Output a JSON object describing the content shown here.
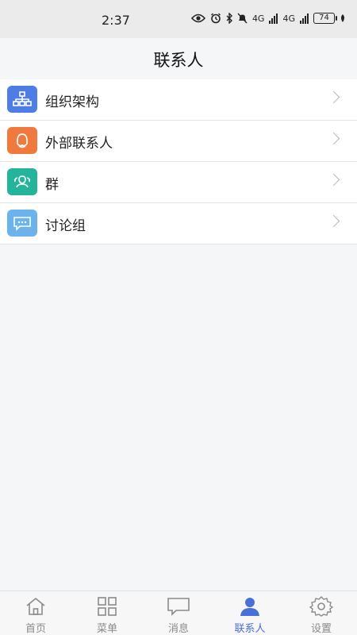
{
  "status_bar": {
    "time": "2:37",
    "battery": "74",
    "network_1": "4G",
    "network_2": "4G"
  },
  "header": {
    "title": "联系人"
  },
  "contacts": [
    {
      "label": "组织架构",
      "icon": "org-chart-icon",
      "color": "#4f7de6"
    },
    {
      "label": "外部联系人",
      "icon": "person-outline-icon",
      "color": "#f07a3e"
    },
    {
      "label": "群",
      "icon": "group-icon",
      "color": "#24b39b"
    },
    {
      "label": "讨论组",
      "icon": "chat-bubble-icon",
      "color": "#6cb3ee"
    }
  ],
  "bottom_nav": [
    {
      "label": "首页",
      "icon": "home-icon",
      "active": false
    },
    {
      "label": "菜单",
      "icon": "grid-icon",
      "active": false
    },
    {
      "label": "消息",
      "icon": "message-icon",
      "active": false
    },
    {
      "label": "联系人",
      "icon": "contact-icon",
      "active": true
    },
    {
      "label": "设置",
      "icon": "gear-icon",
      "active": false
    }
  ],
  "colors": {
    "accent": "#4a6fd8",
    "inactive": "#8a8a8a"
  }
}
